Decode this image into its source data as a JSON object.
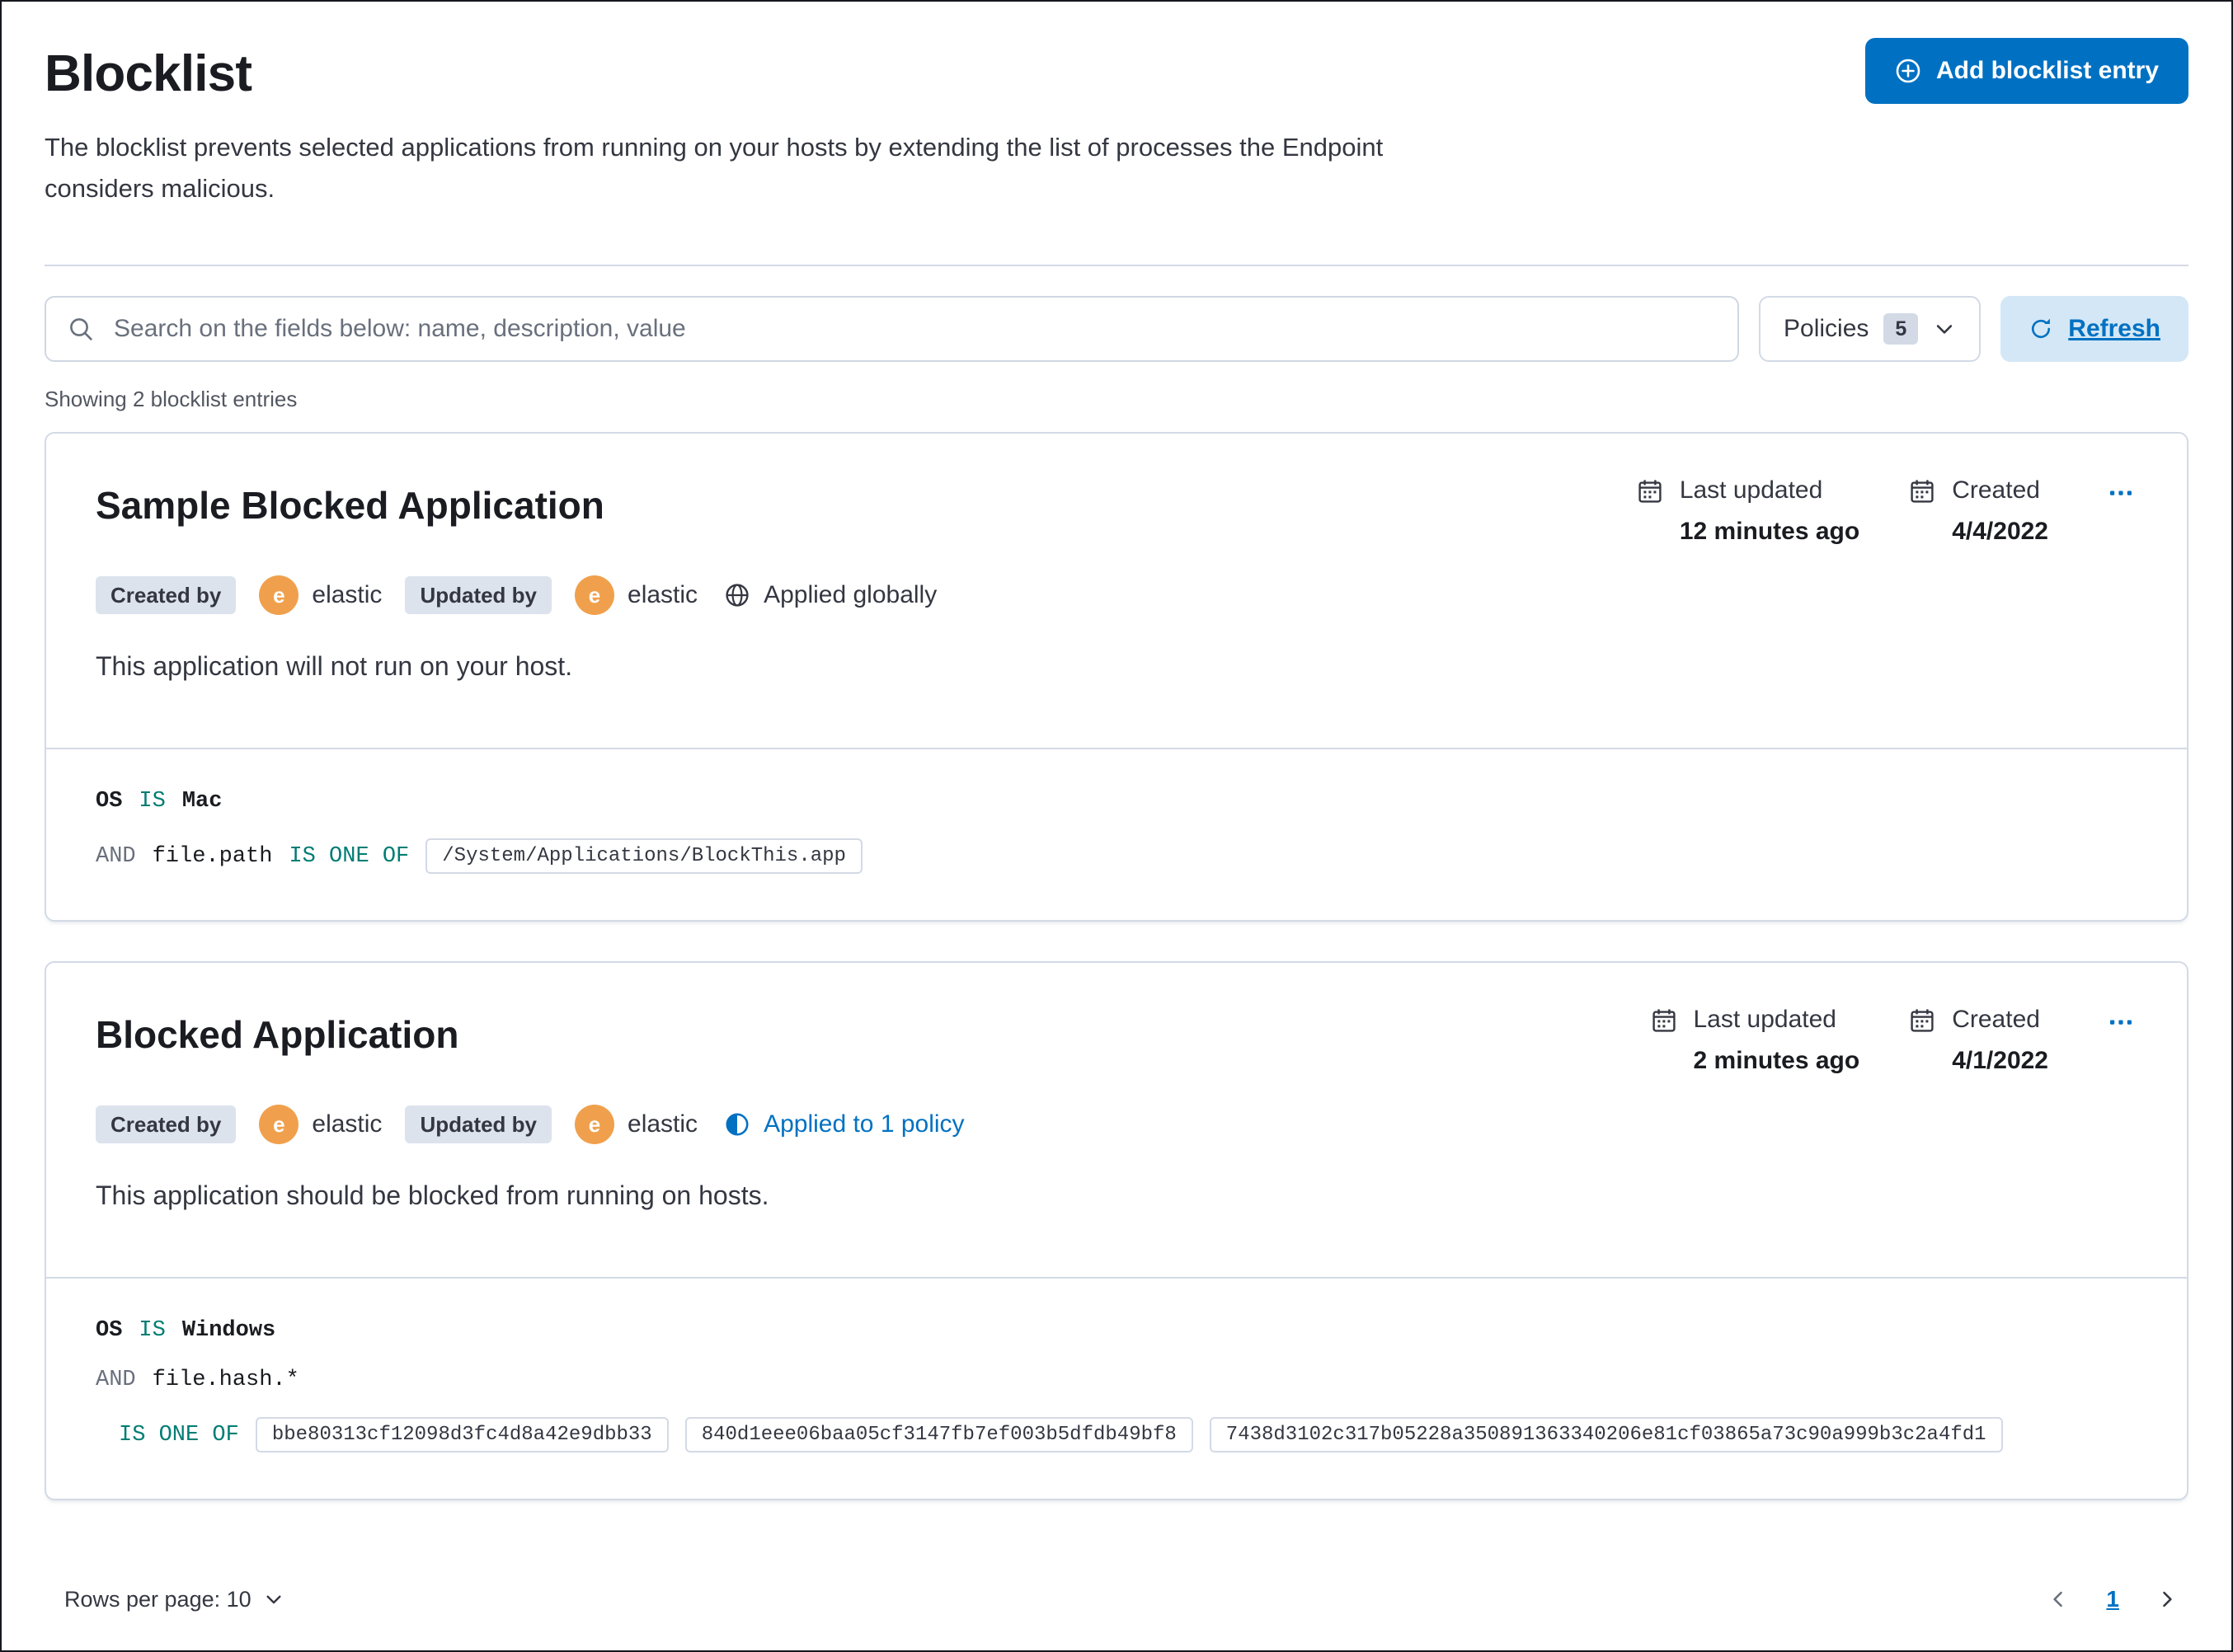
{
  "header": {
    "title": "Blocklist",
    "description": "The blocklist prevents selected applications from running on your hosts by extending the list of processes the Endpoint considers malicious.",
    "add_button_label": "Add blocklist entry"
  },
  "toolbar": {
    "search_placeholder": "Search on the fields below: name, description, value",
    "policies_label": "Policies",
    "policies_count": "5",
    "refresh_label": "Refresh"
  },
  "list": {
    "showing_text": "Showing 2 blocklist entries"
  },
  "entries": [
    {
      "title": "Sample Blocked Application",
      "created_by_label": "Created by",
      "created_by_avatar": "e",
      "created_by_user": "elastic",
      "updated_by_label": "Updated by",
      "updated_by_avatar": "e",
      "updated_by_user": "elastic",
      "applied_text": "Applied globally",
      "last_updated_label": "Last updated",
      "last_updated_value": "12 minutes ago",
      "created_label": "Created",
      "created_value": "4/4/2022",
      "description": "This application will not run on your host.",
      "criteria": {
        "os_field": "OS",
        "os_operator": "IS",
        "os_value": "Mac",
        "conjunction": "AND",
        "field": "file.path",
        "operator": "IS ONE OF",
        "values": [
          "/System/Applications/BlockThis.app"
        ]
      }
    },
    {
      "title": "Blocked Application",
      "created_by_label": "Created by",
      "created_by_avatar": "e",
      "created_by_user": "elastic",
      "updated_by_label": "Updated by",
      "updated_by_avatar": "e",
      "updated_by_user": "elastic",
      "applied_text": "Applied to 1 policy",
      "last_updated_label": "Last updated",
      "last_updated_value": "2 minutes ago",
      "created_label": "Created",
      "created_value": "4/1/2022",
      "description": "This application should be blocked from running on hosts.",
      "criteria": {
        "os_field": "OS",
        "os_operator": "IS",
        "os_value": "Windows",
        "conjunction": "AND",
        "field": "file.hash.*",
        "operator": "IS ONE OF",
        "values": [
          "bbe80313cf12098d3fc4d8a42e9dbb33",
          "840d1eee06baa05cf3147fb7ef003b5dfdb49bf8",
          "7438d3102c317b05228a350891363340206e81cf03865a73c90a999b3c2a4fd1"
        ]
      }
    }
  ],
  "footer": {
    "rows_per_page_label": "Rows per page: 10",
    "page_number": "1"
  },
  "icons": {
    "add": "plus-in-circle",
    "search": "magnifier",
    "policies_chevron": "chevron-down",
    "refresh": "refresh-arrow",
    "date": "calendar",
    "actions_menu": "three-dots-horizontal",
    "applied_globally": "globe",
    "applied_policy": "partial-circle",
    "pagination_prev": "chevron-left",
    "pagination_next": "chevron-right"
  },
  "colors": {
    "primary_blue": "#0071c2",
    "refresh_bg": "#d4e7f6",
    "operator_teal": "#017d73",
    "badge_bg": "#dce3ed",
    "avatar_orange": "#f0a04c",
    "border": "#d3dae6",
    "text": "#343741"
  }
}
